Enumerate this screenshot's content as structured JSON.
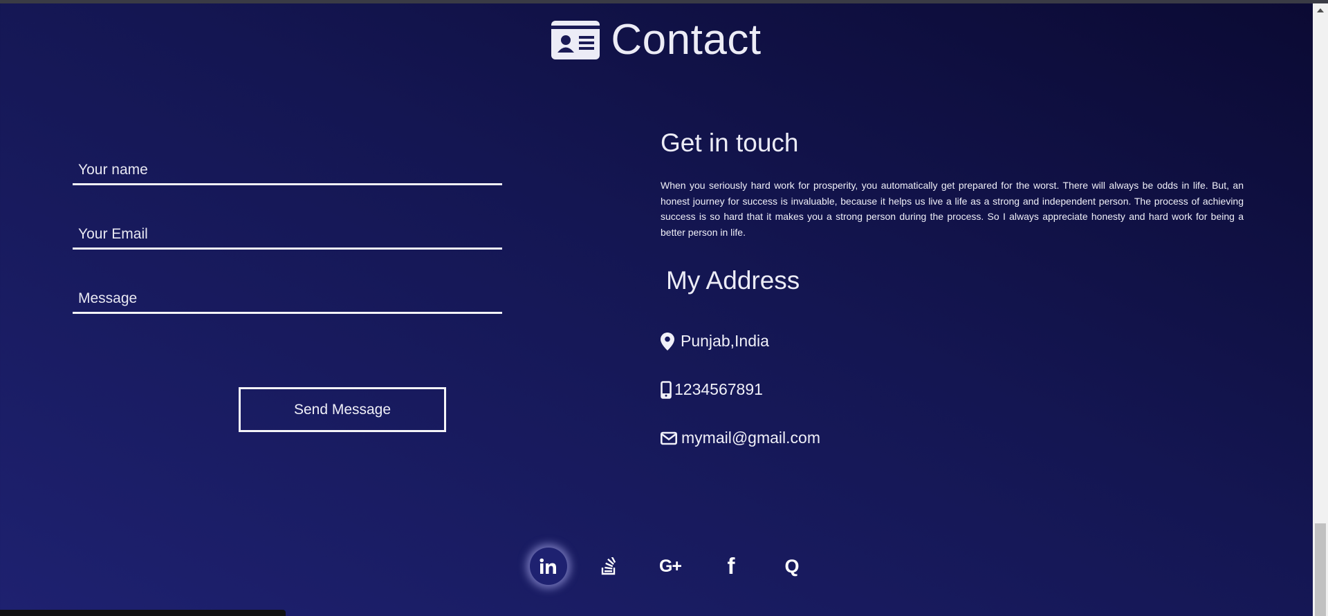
{
  "header": {
    "title": "Contact",
    "icon": "contact-card-icon"
  },
  "form": {
    "name_placeholder": "Your name",
    "email_placeholder": "Your Email",
    "message_placeholder": "Message",
    "send_label": "Send Message"
  },
  "get_in_touch": {
    "title": "Get in touch",
    "text": "When you seriously hard work for prosperity, you automatically get prepared for the worst. There will always be odds in life. But, an honest journey for success is invaluable, because it helps us live a life as a strong and independent person. The process of achieving success is so hard that it makes you a strong person during the process. So I always appreciate honesty and hard work for being a better person in life."
  },
  "address": {
    "title": "My Address",
    "location": "Punjab,India",
    "phone": "1234567891",
    "email": "mymail@gmail.com",
    "icons": [
      "map-marker-icon",
      "mobile-phone-icon",
      "envelope-icon"
    ]
  },
  "social": {
    "icons": [
      "linkedin-icon",
      "stackoverflow-icon",
      "google-plus-icon",
      "facebook-icon",
      "quora-icon"
    ],
    "labels": {
      "linkedin": "in",
      "googleplus": "G+",
      "facebook": "f",
      "quora": "Q"
    }
  },
  "colors": {
    "bg_dark": "#0b0a33",
    "bg_light": "#1e2170",
    "text": "#f0f0f8"
  }
}
